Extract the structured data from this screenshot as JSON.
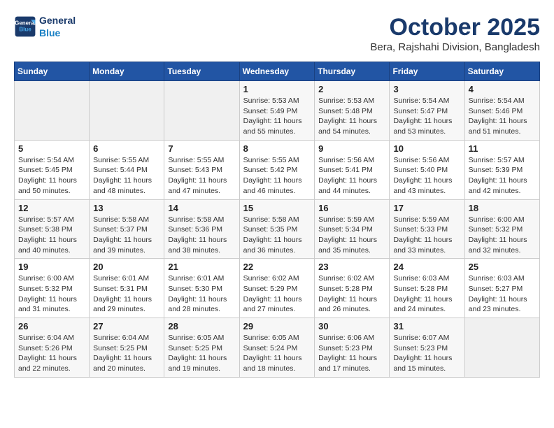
{
  "header": {
    "logo_line1": "General",
    "logo_line2": "Blue",
    "month": "October 2025",
    "location": "Bera, Rajshahi Division, Bangladesh"
  },
  "days_of_week": [
    "Sunday",
    "Monday",
    "Tuesday",
    "Wednesday",
    "Thursday",
    "Friday",
    "Saturday"
  ],
  "weeks": [
    [
      {
        "day": "",
        "info": ""
      },
      {
        "day": "",
        "info": ""
      },
      {
        "day": "",
        "info": ""
      },
      {
        "day": "1",
        "info": "Sunrise: 5:53 AM\nSunset: 5:49 PM\nDaylight: 11 hours\nand 55 minutes."
      },
      {
        "day": "2",
        "info": "Sunrise: 5:53 AM\nSunset: 5:48 PM\nDaylight: 11 hours\nand 54 minutes."
      },
      {
        "day": "3",
        "info": "Sunrise: 5:54 AM\nSunset: 5:47 PM\nDaylight: 11 hours\nand 53 minutes."
      },
      {
        "day": "4",
        "info": "Sunrise: 5:54 AM\nSunset: 5:46 PM\nDaylight: 11 hours\nand 51 minutes."
      }
    ],
    [
      {
        "day": "5",
        "info": "Sunrise: 5:54 AM\nSunset: 5:45 PM\nDaylight: 11 hours\nand 50 minutes."
      },
      {
        "day": "6",
        "info": "Sunrise: 5:55 AM\nSunset: 5:44 PM\nDaylight: 11 hours\nand 48 minutes."
      },
      {
        "day": "7",
        "info": "Sunrise: 5:55 AM\nSunset: 5:43 PM\nDaylight: 11 hours\nand 47 minutes."
      },
      {
        "day": "8",
        "info": "Sunrise: 5:55 AM\nSunset: 5:42 PM\nDaylight: 11 hours\nand 46 minutes."
      },
      {
        "day": "9",
        "info": "Sunrise: 5:56 AM\nSunset: 5:41 PM\nDaylight: 11 hours\nand 44 minutes."
      },
      {
        "day": "10",
        "info": "Sunrise: 5:56 AM\nSunset: 5:40 PM\nDaylight: 11 hours\nand 43 minutes."
      },
      {
        "day": "11",
        "info": "Sunrise: 5:57 AM\nSunset: 5:39 PM\nDaylight: 11 hours\nand 42 minutes."
      }
    ],
    [
      {
        "day": "12",
        "info": "Sunrise: 5:57 AM\nSunset: 5:38 PM\nDaylight: 11 hours\nand 40 minutes."
      },
      {
        "day": "13",
        "info": "Sunrise: 5:58 AM\nSunset: 5:37 PM\nDaylight: 11 hours\nand 39 minutes."
      },
      {
        "day": "14",
        "info": "Sunrise: 5:58 AM\nSunset: 5:36 PM\nDaylight: 11 hours\nand 38 minutes."
      },
      {
        "day": "15",
        "info": "Sunrise: 5:58 AM\nSunset: 5:35 PM\nDaylight: 11 hours\nand 36 minutes."
      },
      {
        "day": "16",
        "info": "Sunrise: 5:59 AM\nSunset: 5:34 PM\nDaylight: 11 hours\nand 35 minutes."
      },
      {
        "day": "17",
        "info": "Sunrise: 5:59 AM\nSunset: 5:33 PM\nDaylight: 11 hours\nand 33 minutes."
      },
      {
        "day": "18",
        "info": "Sunrise: 6:00 AM\nSunset: 5:32 PM\nDaylight: 11 hours\nand 32 minutes."
      }
    ],
    [
      {
        "day": "19",
        "info": "Sunrise: 6:00 AM\nSunset: 5:32 PM\nDaylight: 11 hours\nand 31 minutes."
      },
      {
        "day": "20",
        "info": "Sunrise: 6:01 AM\nSunset: 5:31 PM\nDaylight: 11 hours\nand 29 minutes."
      },
      {
        "day": "21",
        "info": "Sunrise: 6:01 AM\nSunset: 5:30 PM\nDaylight: 11 hours\nand 28 minutes."
      },
      {
        "day": "22",
        "info": "Sunrise: 6:02 AM\nSunset: 5:29 PM\nDaylight: 11 hours\nand 27 minutes."
      },
      {
        "day": "23",
        "info": "Sunrise: 6:02 AM\nSunset: 5:28 PM\nDaylight: 11 hours\nand 26 minutes."
      },
      {
        "day": "24",
        "info": "Sunrise: 6:03 AM\nSunset: 5:28 PM\nDaylight: 11 hours\nand 24 minutes."
      },
      {
        "day": "25",
        "info": "Sunrise: 6:03 AM\nSunset: 5:27 PM\nDaylight: 11 hours\nand 23 minutes."
      }
    ],
    [
      {
        "day": "26",
        "info": "Sunrise: 6:04 AM\nSunset: 5:26 PM\nDaylight: 11 hours\nand 22 minutes."
      },
      {
        "day": "27",
        "info": "Sunrise: 6:04 AM\nSunset: 5:25 PM\nDaylight: 11 hours\nand 20 minutes."
      },
      {
        "day": "28",
        "info": "Sunrise: 6:05 AM\nSunset: 5:25 PM\nDaylight: 11 hours\nand 19 minutes."
      },
      {
        "day": "29",
        "info": "Sunrise: 6:05 AM\nSunset: 5:24 PM\nDaylight: 11 hours\nand 18 minutes."
      },
      {
        "day": "30",
        "info": "Sunrise: 6:06 AM\nSunset: 5:23 PM\nDaylight: 11 hours\nand 17 minutes."
      },
      {
        "day": "31",
        "info": "Sunrise: 6:07 AM\nSunset: 5:23 PM\nDaylight: 11 hours\nand 15 minutes."
      },
      {
        "day": "",
        "info": ""
      }
    ]
  ]
}
